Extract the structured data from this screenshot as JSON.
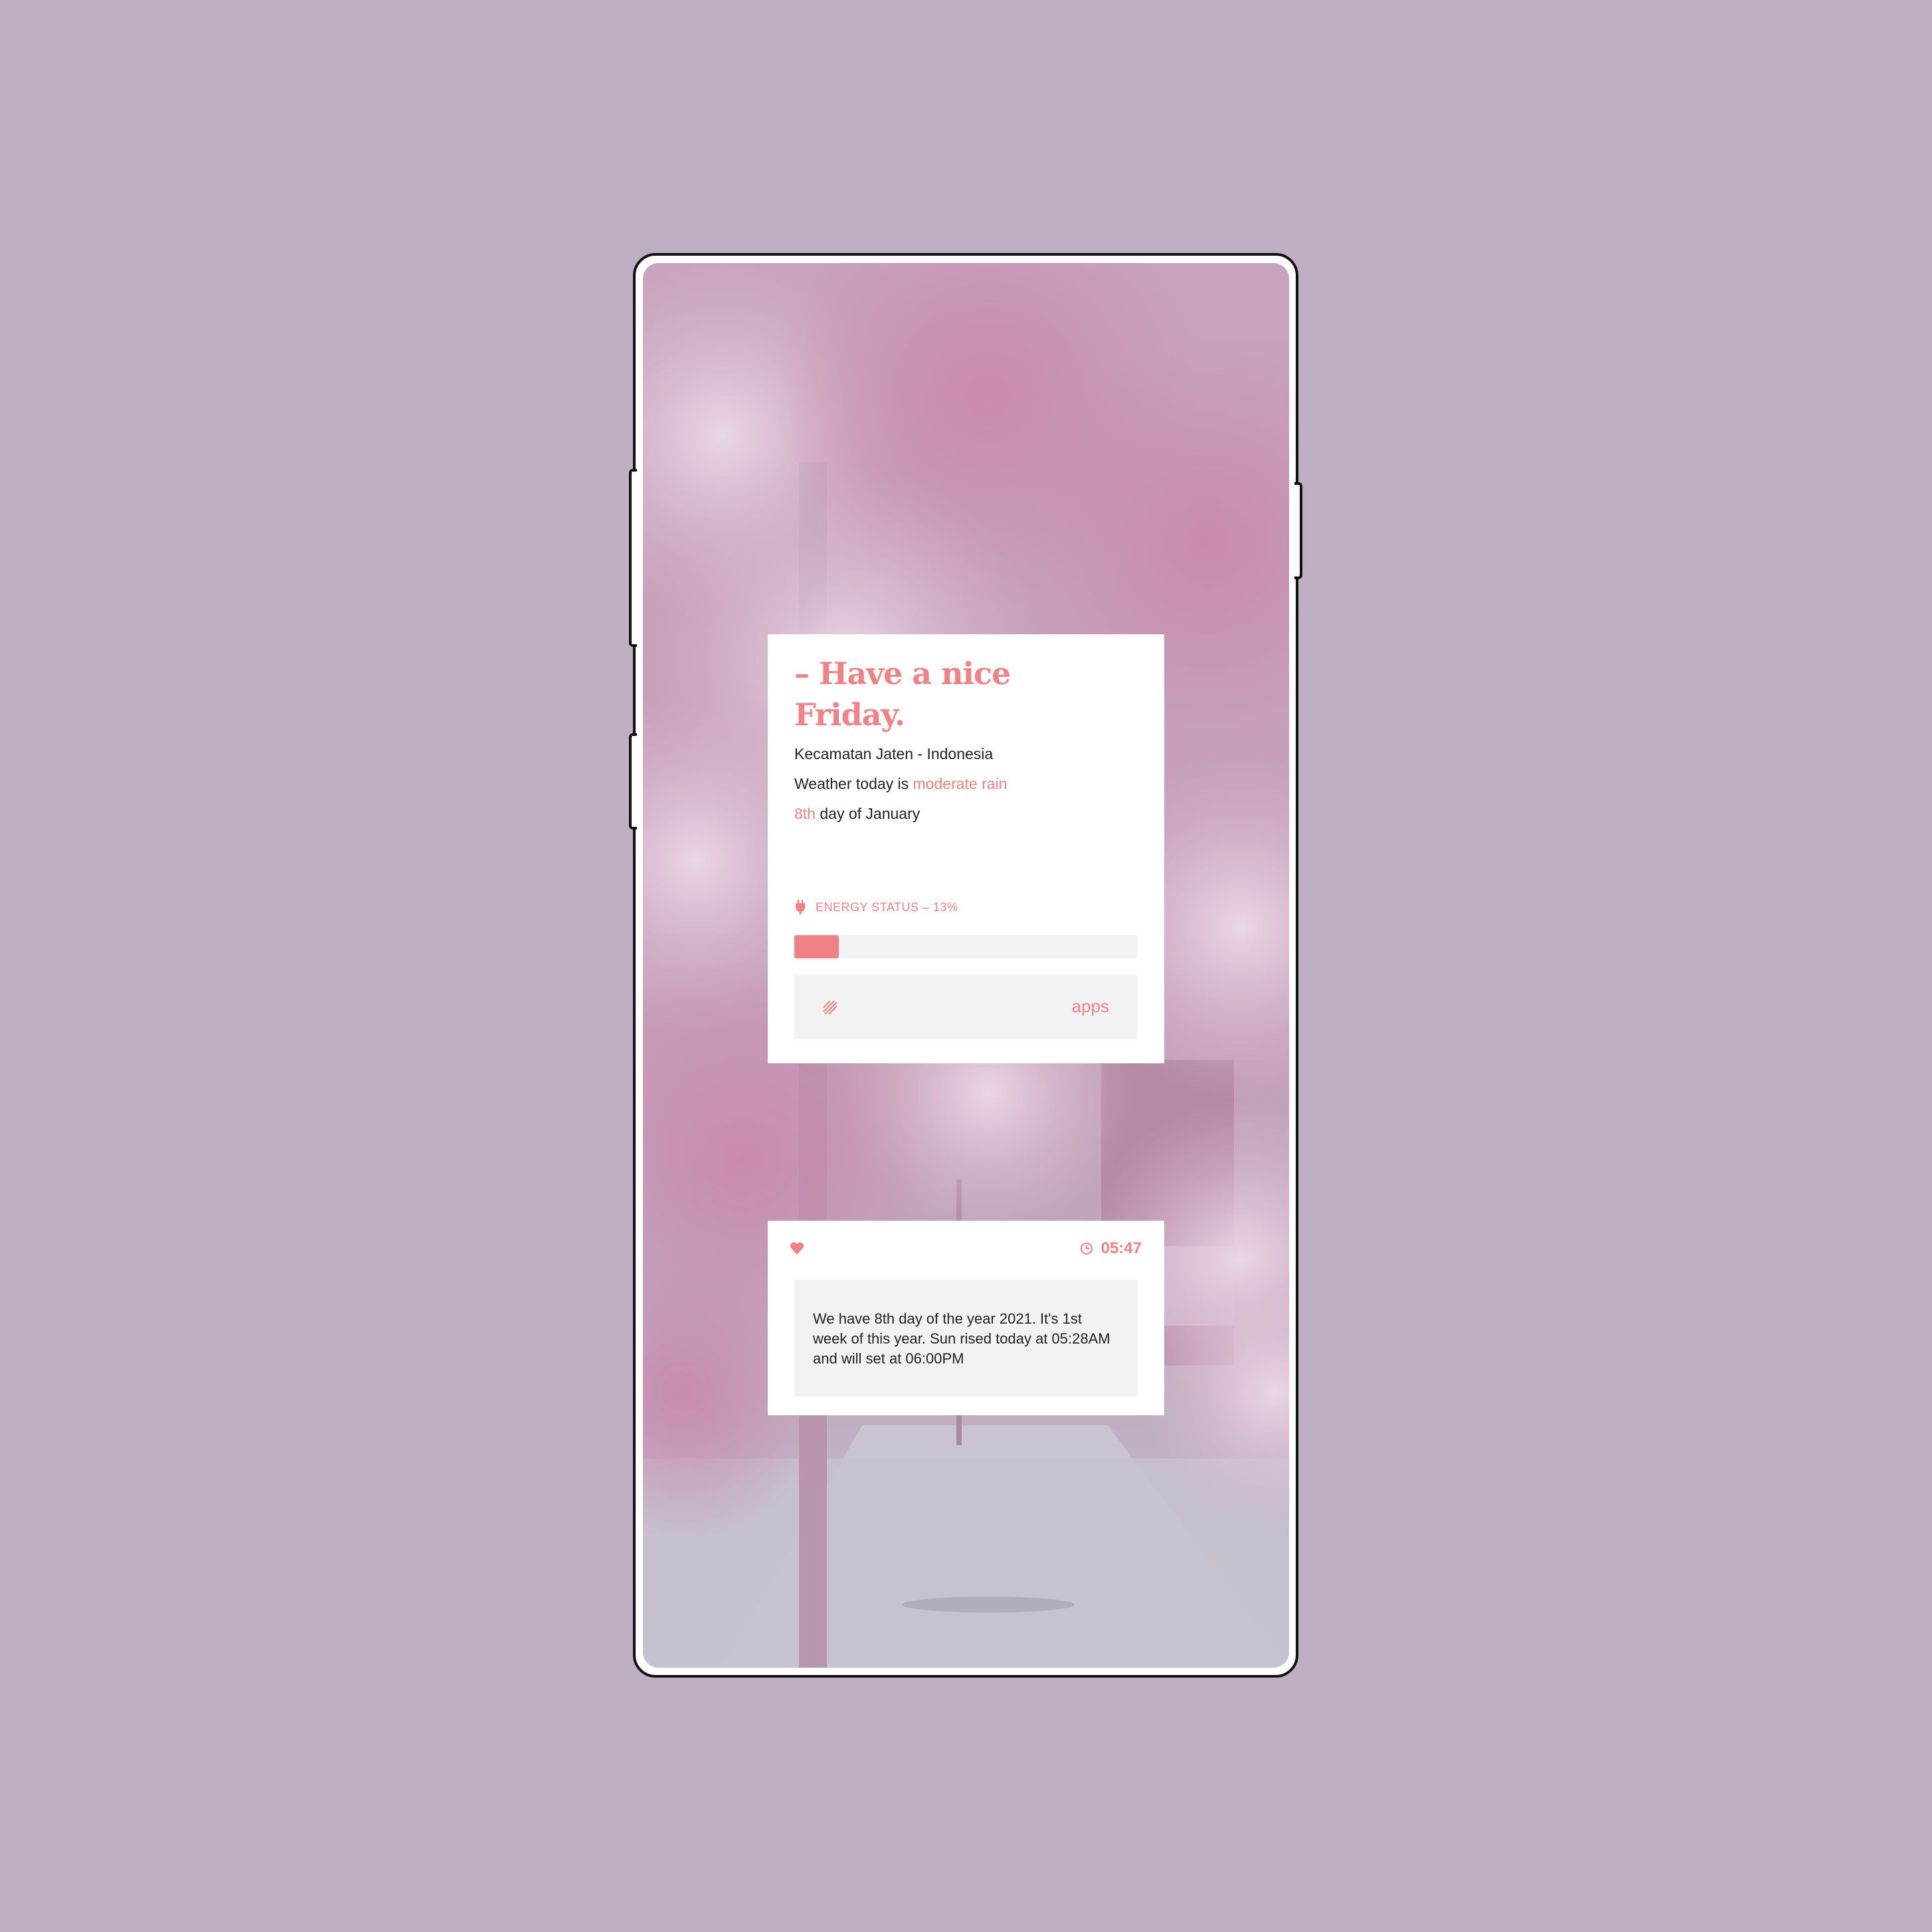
{
  "colors": {
    "page_background": "#bfafc4",
    "accent": "#f08285",
    "card": "#ffffff",
    "panel": "#f2f2f2",
    "text": "#222222"
  },
  "main_card": {
    "greeting": "– Have a nice Friday.",
    "location": "Kecamatan Jaten - Indonesia",
    "weather_prefix": "Weather today is ",
    "weather_value": "moderate rain",
    "day_number": "8th",
    "day_suffix": " day of January",
    "energy": {
      "icon": "bolt-icon",
      "label": "ENERGY STATUS – 13%",
      "level_fraction": 0.13
    },
    "apps": {
      "icon": "striped-square-icon",
      "label": "apps"
    }
  },
  "info_card": {
    "icon": "heart-icon",
    "clock_icon": "clock-icon",
    "time": "05:47",
    "message": "We have 8th day of the year 2021. It's 1st week of this year. Sun rised today at 05:28AM and will set at 06:00PM"
  }
}
